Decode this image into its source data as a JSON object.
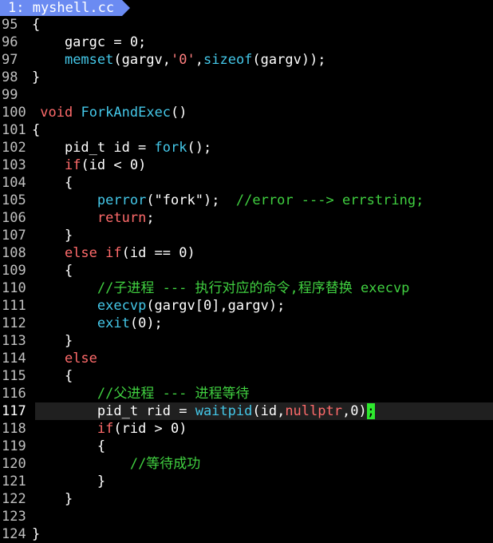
{
  "tab": {
    "label": "1: myshell.cc"
  },
  "lines": [
    {
      "n": "95",
      "segs": [
        [
          "t",
          "{"
        ]
      ]
    },
    {
      "n": "96",
      "segs": [
        [
          "t",
          "    gargc = 0;"
        ]
      ]
    },
    {
      "n": "97",
      "segs": [
        [
          "t",
          "    "
        ],
        [
          "fn",
          "memset"
        ],
        [
          "t",
          "(gargv,"
        ],
        [
          "ch",
          "'0'"
        ],
        [
          "t",
          ","
        ],
        [
          "fn",
          "sizeof"
        ],
        [
          "t",
          "(gargv));"
        ]
      ]
    },
    {
      "n": "98",
      "segs": [
        [
          "t",
          "}"
        ]
      ]
    },
    {
      "n": "99",
      "segs": []
    },
    {
      "n": "100",
      "segs": [
        [
          "t",
          " "
        ],
        [
          "kw",
          "void"
        ],
        [
          "t",
          " "
        ],
        [
          "fn",
          "ForkAndExec"
        ],
        [
          "t",
          "()"
        ]
      ]
    },
    {
      "n": "101",
      "segs": [
        [
          "t",
          "{"
        ]
      ]
    },
    {
      "n": "102",
      "segs": [
        [
          "t",
          "    pid_t id = "
        ],
        [
          "fn",
          "fork"
        ],
        [
          "t",
          "();"
        ]
      ]
    },
    {
      "n": "103",
      "segs": [
        [
          "t",
          "    "
        ],
        [
          "kw",
          "if"
        ],
        [
          "t",
          "(id < 0)"
        ]
      ]
    },
    {
      "n": "104",
      "segs": [
        [
          "t",
          "    {"
        ]
      ]
    },
    {
      "n": "105",
      "segs": [
        [
          "t",
          "        "
        ],
        [
          "fn",
          "perror"
        ],
        [
          "t",
          "(\"fork\");  "
        ],
        [
          "cm",
          "//error ---> errstring;"
        ]
      ]
    },
    {
      "n": "106",
      "segs": [
        [
          "t",
          "        "
        ],
        [
          "kw",
          "return"
        ],
        [
          "t",
          ";"
        ]
      ]
    },
    {
      "n": "107",
      "segs": [
        [
          "t",
          "    }"
        ]
      ]
    },
    {
      "n": "108",
      "segs": [
        [
          "t",
          "    "
        ],
        [
          "kw",
          "else if"
        ],
        [
          "t",
          "(id == 0)"
        ]
      ]
    },
    {
      "n": "109",
      "segs": [
        [
          "t",
          "    {"
        ]
      ]
    },
    {
      "n": "110",
      "segs": [
        [
          "t",
          "        "
        ],
        [
          "cm",
          "//子进程 --- 执行对应的命令,程序替换 execvp"
        ]
      ]
    },
    {
      "n": "111",
      "segs": [
        [
          "t",
          "        "
        ],
        [
          "fn",
          "execvp"
        ],
        [
          "t",
          "(gargv[0],gargv);"
        ]
      ]
    },
    {
      "n": "112",
      "segs": [
        [
          "t",
          "        "
        ],
        [
          "fn",
          "exit"
        ],
        [
          "t",
          "(0);"
        ]
      ]
    },
    {
      "n": "113",
      "segs": [
        [
          "t",
          "    }"
        ]
      ]
    },
    {
      "n": "114",
      "segs": [
        [
          "t",
          "    "
        ],
        [
          "kw",
          "else"
        ]
      ]
    },
    {
      "n": "115",
      "segs": [
        [
          "t",
          "    {"
        ]
      ]
    },
    {
      "n": "116",
      "segs": [
        [
          "t",
          "        "
        ],
        [
          "cm",
          "//父进程 --- 进程等待"
        ]
      ]
    },
    {
      "n": "117",
      "current": true,
      "segs": [
        [
          "t",
          "        pid_t rid = "
        ],
        [
          "fn",
          "waitpid"
        ],
        [
          "t",
          "(id,"
        ],
        [
          "kw",
          "nullptr"
        ],
        [
          "t",
          ",0)"
        ],
        [
          "cur",
          ";"
        ]
      ]
    },
    {
      "n": "118",
      "segs": [
        [
          "t",
          "        "
        ],
        [
          "kw",
          "if"
        ],
        [
          "t",
          "(rid > 0)"
        ]
      ]
    },
    {
      "n": "119",
      "segs": [
        [
          "t",
          "        {"
        ]
      ]
    },
    {
      "n": "120",
      "segs": [
        [
          "t",
          "            "
        ],
        [
          "cm",
          "//等待成功"
        ]
      ]
    },
    {
      "n": "121",
      "segs": [
        [
          "t",
          "        }"
        ]
      ]
    },
    {
      "n": "122",
      "segs": [
        [
          "t",
          "    }"
        ]
      ]
    },
    {
      "n": "123",
      "segs": []
    },
    {
      "n": "124",
      "segs": [
        [
          "t",
          "}"
        ]
      ]
    }
  ],
  "colors": {
    "background": "#000000",
    "keyword": "#ff6b6b",
    "function": "#44c7e8",
    "comment": "#40d040",
    "tab": "#6b8bf2",
    "cursor": "#2ee82e"
  }
}
